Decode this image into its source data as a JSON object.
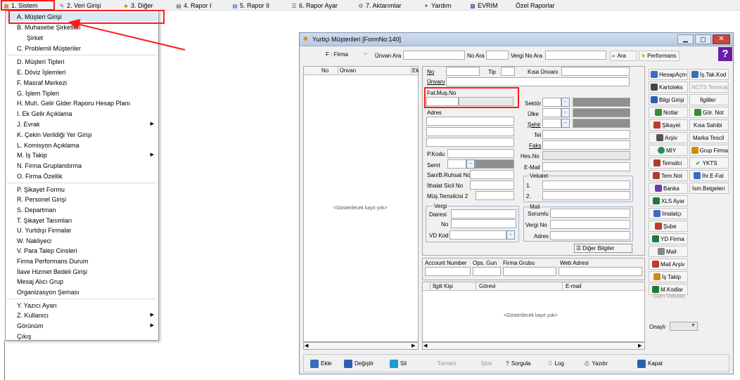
{
  "menubar": {
    "items": [
      {
        "label": "1.  Sistem",
        "icon": "system-icon"
      },
      {
        "label": "2.  Veri Girişi",
        "icon": "data-entry-icon"
      },
      {
        "label": "3.  Diğer",
        "icon": "other-icon"
      },
      {
        "label": "4.  Rapor I",
        "icon": "report-icon"
      },
      {
        "label": "5.  Rapor II",
        "icon": "report-icon"
      },
      {
        "label": "6.  Rapor Ayar",
        "icon": "report-settings-icon"
      },
      {
        "label": "7.  Aktarımlar",
        "icon": "transfer-icon"
      },
      {
        "label": "Yardım",
        "icon": "help-icon"
      },
      {
        "label": "EVRIM",
        "icon": "evrim-icon"
      },
      {
        "label": "Özel Raporlar",
        "icon": ""
      }
    ]
  },
  "dropdown": {
    "items": [
      "A.  Müşteri Girişi",
      "B.  Muhasebe Şirketleri",
      "Şirket",
      "C.  Problemli Müşteriler",
      "D.  Müşteri Tipleri",
      "E.  Döviz İşlemleri",
      "F.  Masraf Merkezi",
      "G.  İşlem Tipleri",
      "H.  Muh. Gelir Gider Raporu Hesap Planı",
      "I.  Ek Gelir Açıklama",
      "J.  Evrak",
      "K.  Çekin Verildiği Yer Girişi",
      "L.  Komisyon Açıklama",
      "M.  İş Takip",
      "N.  Firma Gruplandırma",
      "O.  Firma Özellik",
      "P.  Şikayet Formu",
      "R.  Personel Girişi",
      "S.  Departman",
      "T.  Şikayet Tanımları",
      "U.  Yurtdışı Firmalar",
      "W.  Nakliyeci",
      "V.  Para Talep Cinsleri",
      "Firma Performans Durum",
      "İlave Hizmet Bedeli Girişi",
      "Mesaj Alıcı Grup",
      "Organizasyon Şeması",
      "Y.  Yazıcı Ayarı",
      "Z.  Kullanıcı",
      "Görünüm",
      "Çıkış"
    ]
  },
  "window": {
    "title": "Yurtiçi Müşterileri [FormNo:140]",
    "help_glyph": "?",
    "search": {
      "filter_value": "F : Firma",
      "unvan_label": "Ünvan Ara",
      "no_label": "No Ara",
      "vergi_label": "Vergi No Ara",
      "search_button": "Ara",
      "performance_button": "Performans"
    },
    "list": {
      "col_no": "No",
      "col_unvan": "Ünvan",
      "col_ek": "Ek",
      "empty": "<Gösterilecek kayıt yok>"
    },
    "form": {
      "no": "No",
      "tip": "Tip",
      "kisa_unvan": "Kısa Ünvanı",
      "unvan": "Ünvanı",
      "fat_mus_no": "Fat.Muş.No",
      "adres": "Adres",
      "p_kodu": "P.Kodu",
      "semt": "Semt",
      "sanb": "San/B.Ruhsat No",
      "ithalat": "İthalat Sicil No",
      "mus_temsilcisi": "Müş.Temsilcisi 2",
      "sektor": "Sektör",
      "ulke": "Ülke",
      "sehir": "Şehir",
      "tel": "Tel",
      "faks": "Faks",
      "hes_no": "Hes.No",
      "email": "E-Mail",
      "vekalet": "Vekalet",
      "vek1": "1.",
      "vek2": "2.",
      "vergi": "Vergi",
      "dairesi": "Dairesi",
      "vergi_no": "No",
      "vd_kod": "VD Kod",
      "mali": "Mali",
      "sorumlu": "Sorumlu",
      "vergi_no2": "Vergi No",
      "mali_adres": "Adres",
      "diger_bilgiler": "Diğer Bilgiler"
    },
    "bank": {
      "account": "Account Number",
      "ops_gun": "Ops. Gun",
      "firma_grubu": "Firma Grubu",
      "web": "Web Adresi"
    },
    "contacts": {
      "ilgili": "İlgili Kişi",
      "gorevi": "Görevi",
      "email": "E-mail",
      "empty": "<Gösterilecek kayıt yok>"
    },
    "right_buttons_left": [
      "HesapAçm",
      "Kartoteks",
      "Bilgi Girişi",
      "Notlar",
      "Şikayet",
      "Arşiv",
      "MİY",
      "Temsilci",
      "Tem.Not",
      "Banka",
      "XLS Ayar",
      "İmalatçı",
      "Şube",
      "YD Firma",
      "Mail",
      "Mail Arşiv",
      "İş Takip",
      "M.Kodlar",
      "Güm.Vekalet"
    ],
    "right_buttons_right": [
      "İş.Tak.Kod",
      "NCTS Teminat",
      "İlgililer",
      "Gör. Not",
      "Kısa Sahibi",
      "Marka Tescil",
      "Grup Firma",
      "YKTS",
      "İhr.E-Fat",
      "İsm.Belgeleri"
    ],
    "onayli_label": "Onaylı",
    "bottom": [
      "Ekle",
      "Değiştir",
      "Sil",
      "Tamam",
      "İptal",
      "Sorgula",
      "Log",
      "Yazdır",
      "Kapat"
    ]
  }
}
